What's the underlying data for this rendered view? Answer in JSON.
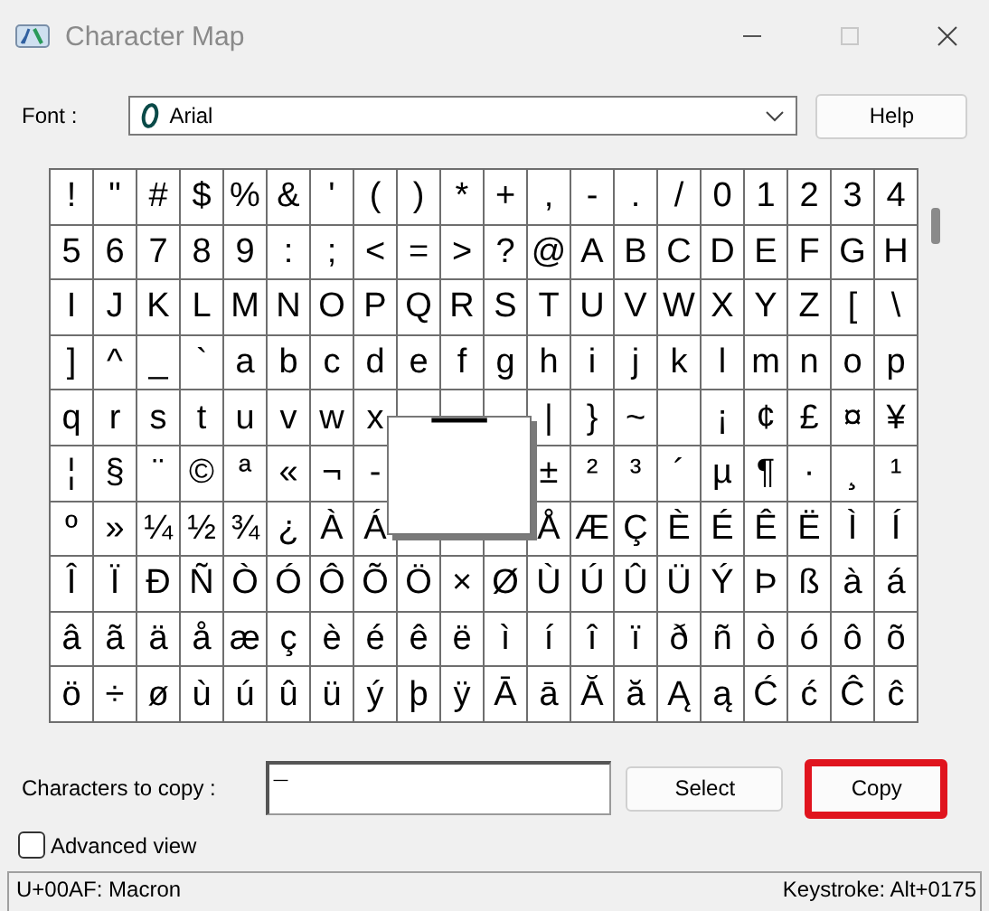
{
  "window": {
    "title": "Character Map"
  },
  "font": {
    "label": "Font :",
    "value": "Arial"
  },
  "help_button": "Help",
  "grid": {
    "rows": [
      [
        "!",
        "\"",
        "#",
        "$",
        "%",
        "&",
        "'",
        "(",
        ")",
        "*",
        "+",
        ",",
        "-",
        ".",
        "/",
        "0",
        "1",
        "2",
        "3",
        "4"
      ],
      [
        "5",
        "6",
        "7",
        "8",
        "9",
        ":",
        ";",
        "<",
        "=",
        ">",
        "?",
        "@",
        "A",
        "B",
        "C",
        "D",
        "E",
        "F",
        "G",
        "H"
      ],
      [
        "I",
        "J",
        "K",
        "L",
        "M",
        "N",
        "O",
        "P",
        "Q",
        "R",
        "S",
        "T",
        "U",
        "V",
        "W",
        "X",
        "Y",
        "Z",
        "[",
        "\\"
      ],
      [
        "]",
        "^",
        "_",
        "`",
        "a",
        "b",
        "c",
        "d",
        "e",
        "f",
        "g",
        "h",
        "i",
        "j",
        "k",
        "l",
        "m",
        "n",
        "o",
        "p"
      ],
      [
        "q",
        "r",
        "s",
        "t",
        "u",
        "v",
        "w",
        "x",
        null,
        null,
        null,
        "|",
        "}",
        "~",
        null,
        "¡",
        "¢",
        "£",
        "¤",
        "¥"
      ],
      [
        "¦",
        "§",
        "¨",
        "©",
        "ª",
        "«",
        "¬",
        "-",
        null,
        null,
        null,
        "±",
        "²",
        "³",
        "´",
        "µ",
        "¶",
        "·",
        "¸",
        "¹"
      ],
      [
        "º",
        "»",
        "¼",
        "½",
        "¾",
        "¿",
        "À",
        "Á",
        null,
        null,
        null,
        "Å",
        "Æ",
        "Ç",
        "È",
        "É",
        "Ê",
        "Ë",
        "Ì",
        "Í"
      ],
      [
        "Î",
        "Ï",
        "Ð",
        "Ñ",
        "Ò",
        "Ó",
        "Ô",
        "Õ",
        "Ö",
        "×",
        "Ø",
        "Ù",
        "Ú",
        "Û",
        "Ü",
        "Ý",
        "Þ",
        "ß",
        "à",
        "á"
      ],
      [
        "â",
        "ã",
        "ä",
        "å",
        "æ",
        "ç",
        "è",
        "é",
        "ê",
        "ë",
        "ì",
        "í",
        "î",
        "ï",
        "ð",
        "ñ",
        "ò",
        "ó",
        "ô",
        "õ"
      ],
      [
        "ö",
        "÷",
        "ø",
        "ù",
        "ú",
        "û",
        "ü",
        "ý",
        "þ",
        "ÿ",
        "Ā",
        "ā",
        "Ă",
        "ă",
        "Ą",
        "ą",
        "Ć",
        "ć",
        "Ĉ",
        "ĉ"
      ]
    ],
    "magnified": "¯"
  },
  "copy_row": {
    "label": "Characters to copy :",
    "value": "¯",
    "buttons": [
      {
        "label": "Select",
        "highlighted": false
      },
      {
        "label": "Copy",
        "highlighted": true
      }
    ]
  },
  "advanced_view": {
    "label": "Advanced view",
    "checked": false
  },
  "status_bar": {
    "character": "U+00AF: Macron",
    "keystroke": "Keystroke: Alt+0175"
  }
}
